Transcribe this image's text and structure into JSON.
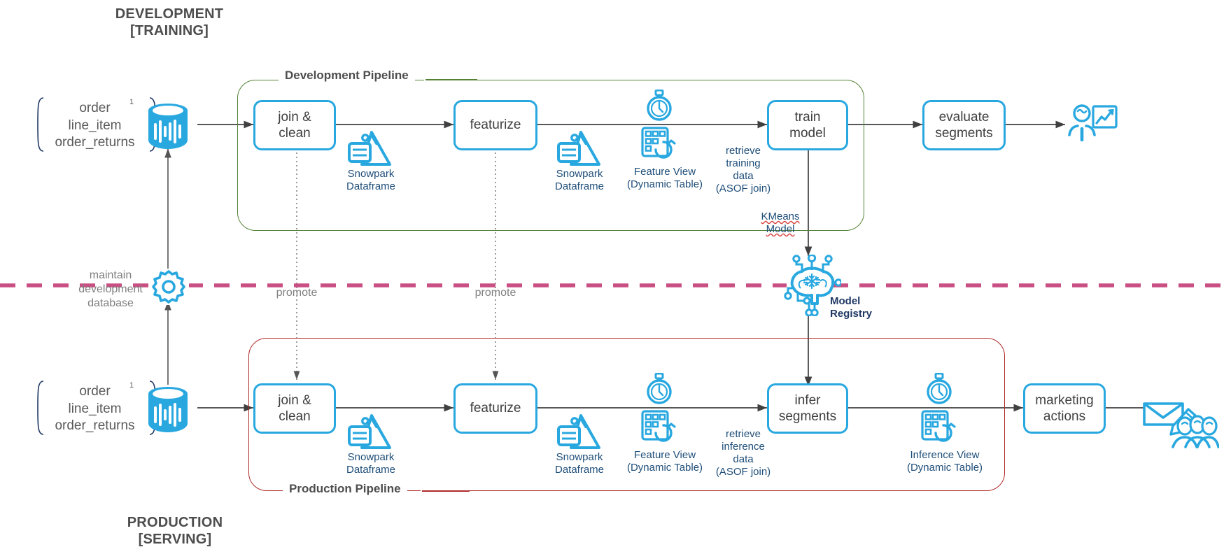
{
  "diagram": {
    "title_top": "DEVELOPMENT\n[TRAINING]",
    "title_bottom": "PRODUCTION\n[SERVING]",
    "colors": {
      "snowflake_blue": "#29a8e0",
      "dev_frame_green": "#548235",
      "prod_frame_red": "#af2b2b",
      "divider_pink": "#c94f82",
      "box_text": "#3f3f3f",
      "annotation_blue": "#1f4e79",
      "annotation_gray": "#808080",
      "registry_navy": "#1f3864"
    }
  },
  "dev_pipeline": {
    "frame_label": "Development Pipeline",
    "source": {
      "tables": "order\nline_item\norder_returns",
      "footnote": "1",
      "icon": "database-cylinder-icon"
    },
    "steps": [
      {
        "label": "join &\nclean",
        "name": "join-clean"
      },
      {
        "label": "featurize",
        "name": "featurize"
      },
      {
        "label": "train\nmodel",
        "name": "train-model"
      },
      {
        "label": "evaluate\nsegments",
        "name": "evaluate-segments"
      }
    ],
    "artifacts": [
      {
        "label": "Snowpark\nDataframe",
        "icon": "snowpark-dataframe-icon"
      },
      {
        "label": "Snowpark\nDataframe",
        "icon": "snowpark-dataframe-icon"
      },
      {
        "label": "Feature View\n(Dynamic Table)",
        "icon": "feature-view-icon",
        "clock": "stopwatch-icon"
      }
    ],
    "edge_labels": {
      "retrieve": "retrieve\ntraining\ndata\n(ASOF join)",
      "model_out": "KMeans\nModel"
    },
    "output_icon": "analyst-presentation-icon"
  },
  "prod_pipeline": {
    "frame_label": "Production Pipeline",
    "source": {
      "tables": "order\nline_item\norder_returns",
      "footnote": "1",
      "icon": "database-cylinder-icon"
    },
    "steps": [
      {
        "label": "join &\nclean",
        "name": "join-clean"
      },
      {
        "label": "featurize",
        "name": "featurize"
      },
      {
        "label": "infer\nsegments",
        "name": "infer-segments"
      },
      {
        "label": "marketing\nactions",
        "name": "marketing-actions"
      }
    ],
    "artifacts": [
      {
        "label": "Snowpark\nDataframe",
        "icon": "snowpark-dataframe-icon"
      },
      {
        "label": "Snowpark\nDataframe",
        "icon": "snowpark-dataframe-icon"
      },
      {
        "label": "Feature View\n(Dynamic Table)",
        "icon": "feature-view-icon",
        "clock": "stopwatch-icon"
      },
      {
        "label": "Inference View\n(Dynamic Table)",
        "icon": "inference-view-icon",
        "clock": "stopwatch-icon"
      }
    ],
    "edge_labels": {
      "retrieve": "retrieve\ninference\ndata\n(ASOF join)"
    },
    "output_icon": "email-audience-icon"
  },
  "divider": {
    "gear_icon": "gear-icon",
    "maintain_label": "maintain\ndevelopment\ndatabase",
    "promote_label_1": "promote",
    "promote_label_2": "promote"
  },
  "model_registry": {
    "label": "Model\nRegistry",
    "icon": "brain-circuit-snowflake-icon"
  }
}
